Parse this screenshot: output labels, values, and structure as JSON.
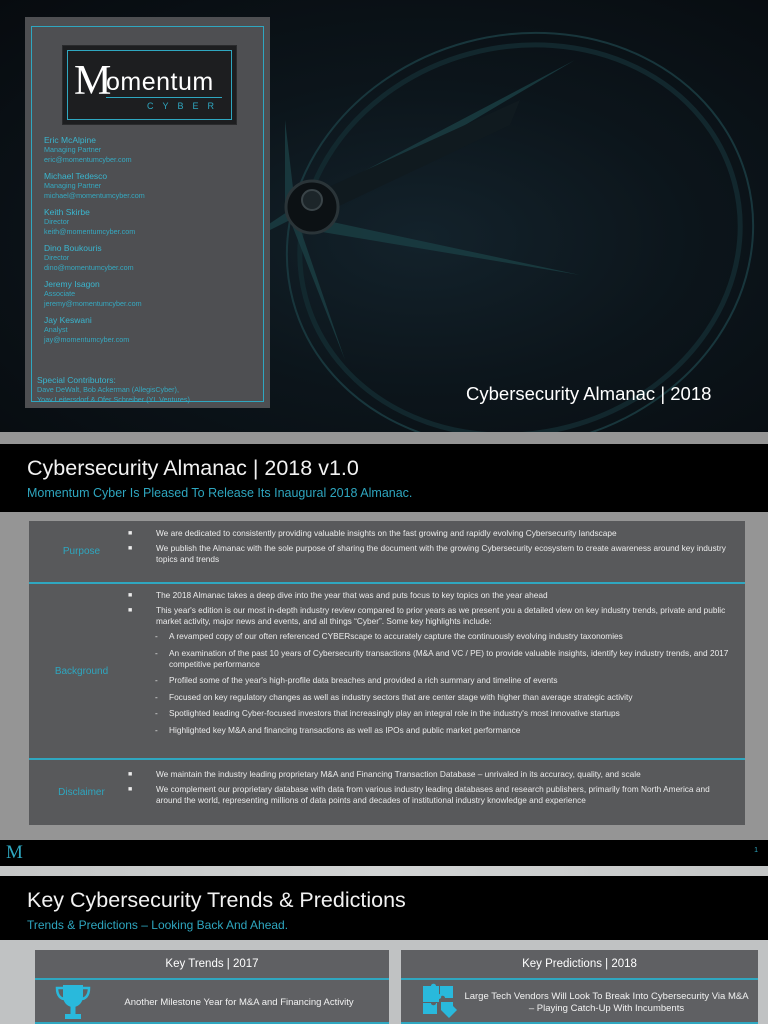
{
  "cover": {
    "logo": {
      "letter": "M",
      "word": "omentum",
      "sub": "CYBER"
    },
    "contacts": [
      {
        "name": "Eric McAlpine",
        "role": "Managing Partner",
        "email": "eric@momentumcyber.com"
      },
      {
        "name": "Michael Tedesco",
        "role": "Managing Partner",
        "email": "michael@momentumcyber.com"
      },
      {
        "name": "Keith Skirbe",
        "role": "Director",
        "email": "keith@momentumcyber.com"
      },
      {
        "name": "Dino Boukouris",
        "role": "Director",
        "email": "dino@momentumcyber.com"
      },
      {
        "name": "Jeremy Isagon",
        "role": "Associate",
        "email": "jeremy@momentumcyber.com"
      },
      {
        "name": "Jay Keswani",
        "role": "Analyst",
        "email": "jay@momentumcyber.com"
      }
    ],
    "contributors": {
      "title": "Special Contributors:",
      "lines": [
        "Dave DeWalt, Bob Ackerman (AllegisCyber),",
        "Yoav Leitersdorf & Ofer Schreiber (YL Ventures)"
      ]
    },
    "title": "Cybersecurity Almanac | 2018"
  },
  "slide1": {
    "title": "Cybersecurity Almanac | 2018 v1.0",
    "subtitle": "Momentum Cyber Is Pleased To Release Its Inaugural 2018 Almanac.",
    "rows": [
      {
        "label": "Purpose",
        "bullets": [
          "We are dedicated to consistently providing valuable insights on the fast growing and rapidly evolving Cybersecurity landscape",
          "We publish the Almanac with the sole purpose of sharing the document with the growing Cybersecurity ecosystem to create awareness around key industry topics and trends"
        ]
      },
      {
        "label": "Background",
        "bullets": [
          "The 2018 Almanac takes a deep dive into the year that was and puts focus to key topics on the year ahead",
          "This year's edition is our most in-depth industry review compared to prior years as we present you a detailed view on key industry trends, private and public market activity, major news and events, and all things “Cyber”. Some key highlights include:"
        ],
        "subbullets": [
          "A revamped copy of our often referenced CYBERscape to accurately capture the continuously evolving industry taxonomies",
          "An examination of the past 10 years of Cybersecurity transactions (M&A and VC / PE) to provide valuable insights, identify key industry trends, and 2017 competitive performance",
          "Profiled some of the year's high-profile data breaches and provided a rich summary and timeline of events",
          "Focused on key regulatory changes as well as industry sectors that are center stage with higher than average strategic activity",
          "Spotlighted leading Cyber-focused investors that increasingly play an integral role in the industry's most innovative startups",
          "Highlighted key M&A and financing transactions as well as IPOs and public market performance"
        ]
      },
      {
        "label": "Disclaimer",
        "bullets": [
          "We maintain the industry leading proprietary M&A and Financing Transaction Database – unrivaled in its accuracy, quality, and scale",
          "We complement our proprietary database with data from various industry leading databases and research publishers, primarily from North America and around the world, representing millions of data points and decades of institutional industry knowledge and experience"
        ]
      }
    ],
    "footer": {
      "logo_letter": "M",
      "page_number": "1"
    }
  },
  "slide2": {
    "title": "Key Cybersecurity Trends & Predictions",
    "subtitle": "Trends & Predictions – Looking Back And Ahead.",
    "cards": [
      {
        "heading": "Key Trends | 2017",
        "icon": "trophy-icon",
        "text": "Another Milestone Year for M&A and Financing Activity"
      },
      {
        "heading": "Key Predictions | 2018",
        "icon": "puzzle-icon",
        "text": "Large Tech Vendors Will Look To Break Into Cybersecurity Via M&A – Playing Catch-Up With Incumbents"
      }
    ]
  },
  "colors": {
    "accent": "#2fa7c0",
    "panel": "#58595b",
    "header": "#000000"
  }
}
